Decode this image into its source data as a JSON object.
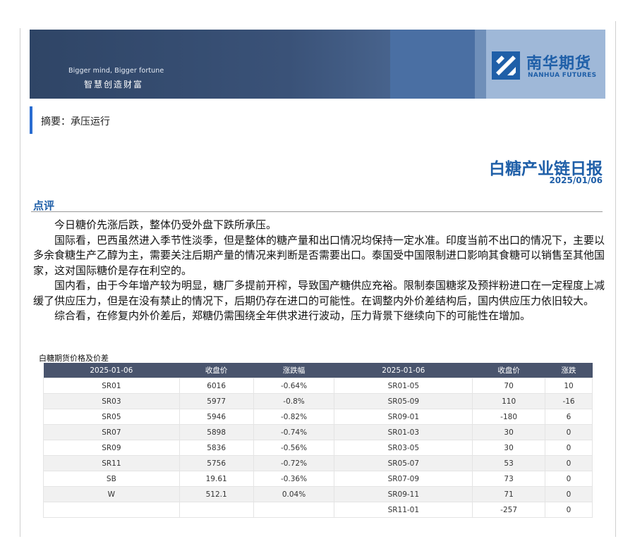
{
  "banner": {
    "slogan_en": "Bigger mind, Bigger fortune",
    "slogan_cn": "智慧创造财富",
    "logo_cn": "南华期货",
    "logo_en": "NANHUA FUTURES"
  },
  "summary": {
    "text": "摘要：承压运行"
  },
  "report": {
    "title": "白糖产业链日报",
    "date": "2025/01/06"
  },
  "section": {
    "title": "点评",
    "paragraphs": [
      "今日糖价先涨后跌，整体仍受外盘下跌所承压。",
      "国际看，巴西虽然进入季节性淡季，但是整体的糖产量和出口情况均保持一定水准。印度当前不出口的情况下，主要以多余食糖生产乙醇为主，需要关注后期产量的情况来判断是否需要出口。泰国受中国限制进口影响其食糖可以销售至其他国家，这对国际糖价是存在利空的。",
      "国内看，由于今年增产较为明显，糖厂多提前开榨，导致国产糖供应充裕。限制泰国糖浆及预拌粉进口在一定程度上减缓了供应压力，但是在没有禁止的情况下，后期仍存在进口的可能性。在调整内外价差结构后，国内供应压力依旧较大。",
      "综合看，在修复内外价差后，郑糖仍需围绕全年供求进行波动，压力背景下继续向下的可能性在增加。"
    ]
  },
  "table": {
    "caption": "白糖期货价格及价差",
    "headers": [
      "2025-01-06",
      "收盘价",
      "涨跌幅",
      "2025-01-06",
      "收盘价",
      "涨跌"
    ],
    "rows": [
      [
        "SR01",
        "6016",
        "-0.64%",
        "SR01-05",
        "70",
        "10"
      ],
      [
        "SR03",
        "5977",
        "-0.8%",
        "SR05-09",
        "110",
        "-16"
      ],
      [
        "SR05",
        "5946",
        "-0.82%",
        "SR09-01",
        "-180",
        "6"
      ],
      [
        "SR07",
        "5898",
        "-0.74%",
        "SR01-03",
        "30",
        "0"
      ],
      [
        "SR09",
        "5836",
        "-0.56%",
        "SR03-05",
        "30",
        "0"
      ],
      [
        "SR11",
        "5756",
        "-0.72%",
        "SR05-07",
        "53",
        "0"
      ],
      [
        "SB",
        "19.61",
        "-0.36%",
        "SR07-09",
        "73",
        "0"
      ],
      [
        "W",
        "512.1",
        "0.04%",
        "SR09-11",
        "71",
        "0"
      ],
      [
        "",
        "",
        "",
        "SR11-01",
        "-257",
        "0"
      ]
    ]
  },
  "colors": {
    "brand_blue": "#1f5fa8",
    "banner_dark": "#2f4566",
    "table_header": "#49546d",
    "summary_accent": "#2a6dd1"
  }
}
